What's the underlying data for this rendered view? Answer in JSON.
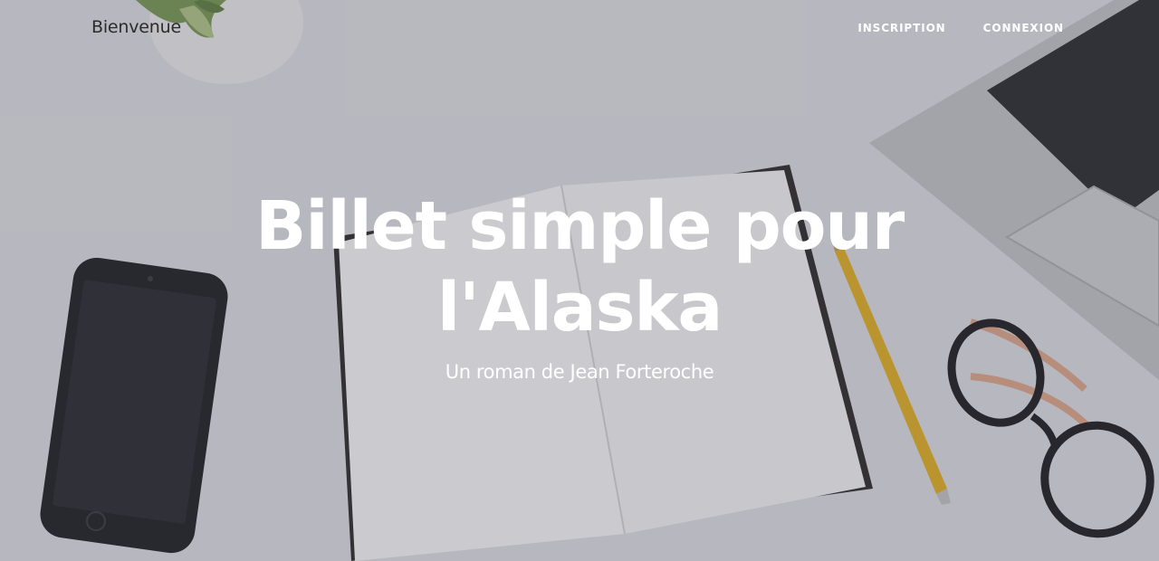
{
  "navbar": {
    "brand": "Bienvenue",
    "links": [
      {
        "label": "INSCRIPTION"
      },
      {
        "label": "CONNEXION"
      }
    ]
  },
  "masthead": {
    "title": "Billet simple pour l'Alaska",
    "subtitle": "Un roman de Jean Forteroche"
  },
  "background": {
    "icons": [
      "plant-icon",
      "smartphone-icon",
      "notebook-icon",
      "pencil-icon",
      "glasses-icon",
      "laptop-icon"
    ]
  },
  "colors": {
    "text_light": "#ffffff",
    "text_dark": "#2b2b2b"
  }
}
